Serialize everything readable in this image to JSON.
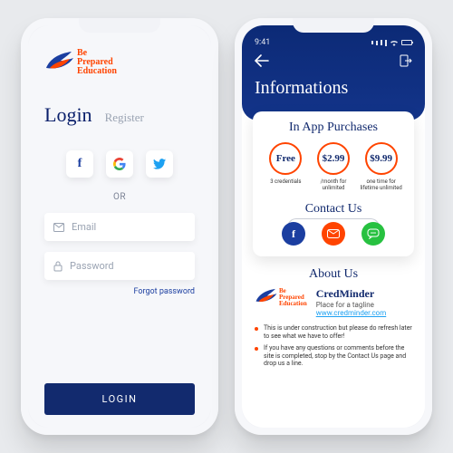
{
  "brand": {
    "line1": "Be",
    "line2": "Prepared",
    "line3": "Education"
  },
  "login": {
    "tab_login": "Login",
    "tab_register": "Register",
    "or": "OR",
    "email_placeholder": "Email",
    "password_placeholder": "Password",
    "forgot": "Forgot password",
    "button": "LOGIN"
  },
  "info": {
    "time": "9:41",
    "title": "Informations",
    "purchases": {
      "heading": "In App Purchases",
      "plans": [
        {
          "price": "Free",
          "desc": "3 credentials"
        },
        {
          "price": "$2.99",
          "desc": "/month for unlimited"
        },
        {
          "price": "$9.99",
          "desc": "one time for lifetime unlimited"
        }
      ]
    },
    "contact": {
      "heading": "Contact Us"
    },
    "about": {
      "heading": "About Us",
      "name": "CredMinder",
      "tagline": "Place for a tagline",
      "url": "www.credminder.com"
    },
    "bullets": [
      "This is under construction but please do refresh later to see what we have to offer!",
      "If you have any questions or comments before the site is completed, stop by the Contact Us page and drop us a line."
    ]
  }
}
